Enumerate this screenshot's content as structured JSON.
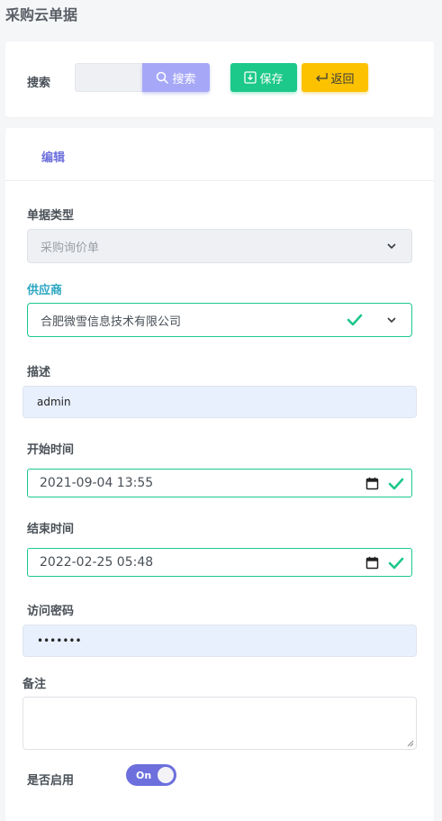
{
  "page": {
    "title": "采购云单据"
  },
  "search": {
    "label": "搜索",
    "input_value": "",
    "button_label": "搜索"
  },
  "toolbar": {
    "save_label": "保存",
    "back_label": "返回"
  },
  "tabs": [
    {
      "label": "编辑",
      "active": true
    }
  ],
  "form": {
    "doc_type": {
      "label": "单据类型",
      "value": "采购询价单",
      "disabled": true
    },
    "supplier": {
      "label": "供应商",
      "value": "合肥微雪信息技术有限公司",
      "valid": true
    },
    "description": {
      "label": "描述",
      "value": "admin"
    },
    "start_time": {
      "label": "开始时间",
      "value": "2021-09-04 13:55",
      "valid": true
    },
    "end_time": {
      "label": "结束时间",
      "value": "2022-02-25 05:48",
      "valid": true
    },
    "access_password": {
      "label": "访问密码",
      "value": "•••••••"
    },
    "remark": {
      "label": "备注",
      "value": ""
    },
    "enabled": {
      "label": "是否启用",
      "toggle_text": "On",
      "on": true
    }
  },
  "colors": {
    "accent": "#6c6fdc",
    "success": "#1cc88a",
    "warning": "#fcc200",
    "search_button": "#a6a8f7",
    "label_teal": "#2aa5c2"
  },
  "icons": [
    "search-icon",
    "save-icon",
    "return-icon",
    "chevron-down-icon",
    "check-icon",
    "calendar-icon"
  ]
}
